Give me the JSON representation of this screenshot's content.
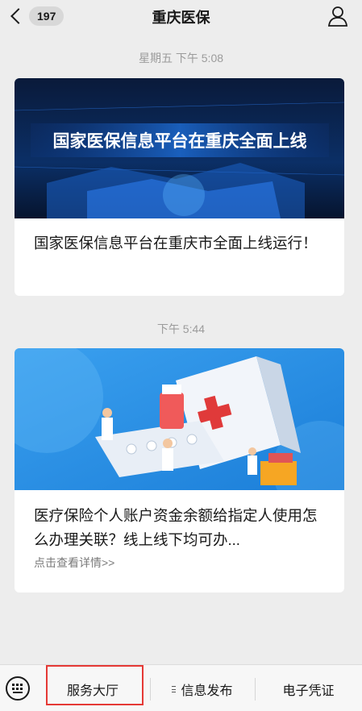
{
  "header": {
    "unread_count": "197",
    "title": "重庆医保"
  },
  "messages": [
    {
      "timestamp": "星期五 下午 5:08",
      "banner_text": "国家医保信息平台在重庆全面上线",
      "title": "国家医保信息平台在重庆市全面上线运行！"
    },
    {
      "timestamp": "下午 5:44",
      "title": "医疗保险个人账户资金余额给指定人使用怎么办理关联？线上线下均可办...",
      "detail_link": "点击查看详情>>"
    }
  ],
  "bottom_menu": {
    "items": [
      {
        "label": "服务大厅"
      },
      {
        "label": "信息发布"
      },
      {
        "label": "电子凭证"
      }
    ]
  },
  "colors": {
    "highlight": "#e53935",
    "background": "#ededed"
  },
  "icons": {
    "back": "back-arrow-icon",
    "profile": "profile-icon",
    "keyboard": "keyboard-icon",
    "submenu": "menu-lines-icon"
  }
}
